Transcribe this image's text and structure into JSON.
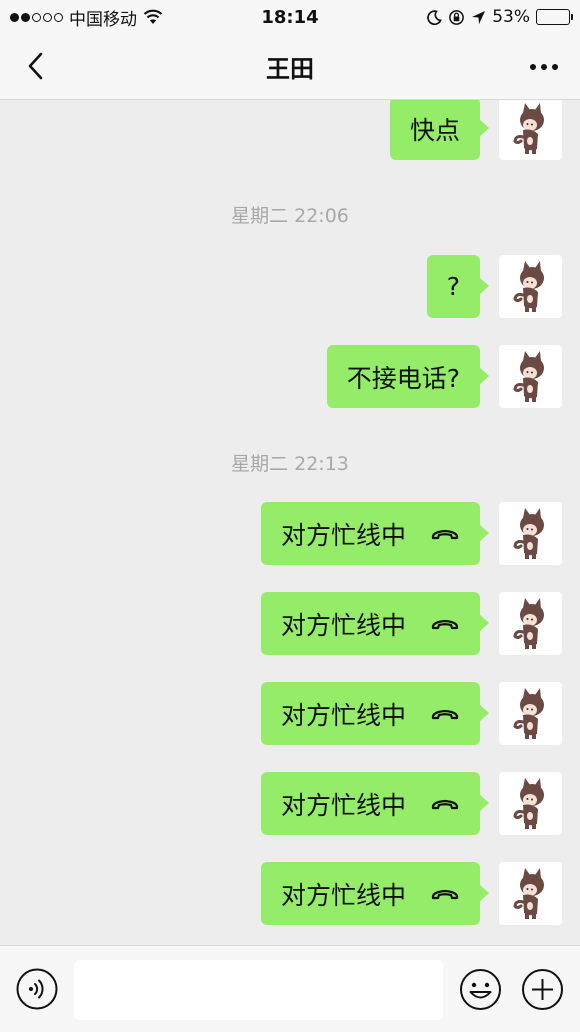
{
  "status_bar": {
    "carrier": "中国移动",
    "time": "18:14",
    "battery_percent": "53%",
    "battery_level": 0.53
  },
  "nav": {
    "title": "王田"
  },
  "messages": [
    {
      "type": "text",
      "text": "快点"
    },
    {
      "type": "time",
      "text": "星期二 22:06"
    },
    {
      "type": "text",
      "text": "?"
    },
    {
      "type": "text",
      "text": "不接电话?"
    },
    {
      "type": "time",
      "text": "星期二 22:13"
    },
    {
      "type": "call",
      "text": "对方忙线中"
    },
    {
      "type": "call",
      "text": "对方忙线中"
    },
    {
      "type": "call",
      "text": "对方忙线中"
    },
    {
      "type": "call",
      "text": "对方忙线中"
    },
    {
      "type": "call",
      "text": "对方忙线中"
    }
  ],
  "colors": {
    "bubble": "#95ec69",
    "background": "#ededed"
  },
  "icons": {
    "back": "chevron-left-icon",
    "more": "more-dots-icon",
    "voice": "voice-icon",
    "emoji": "emoji-icon",
    "plus": "plus-icon",
    "call": "phone-hangup-icon"
  }
}
